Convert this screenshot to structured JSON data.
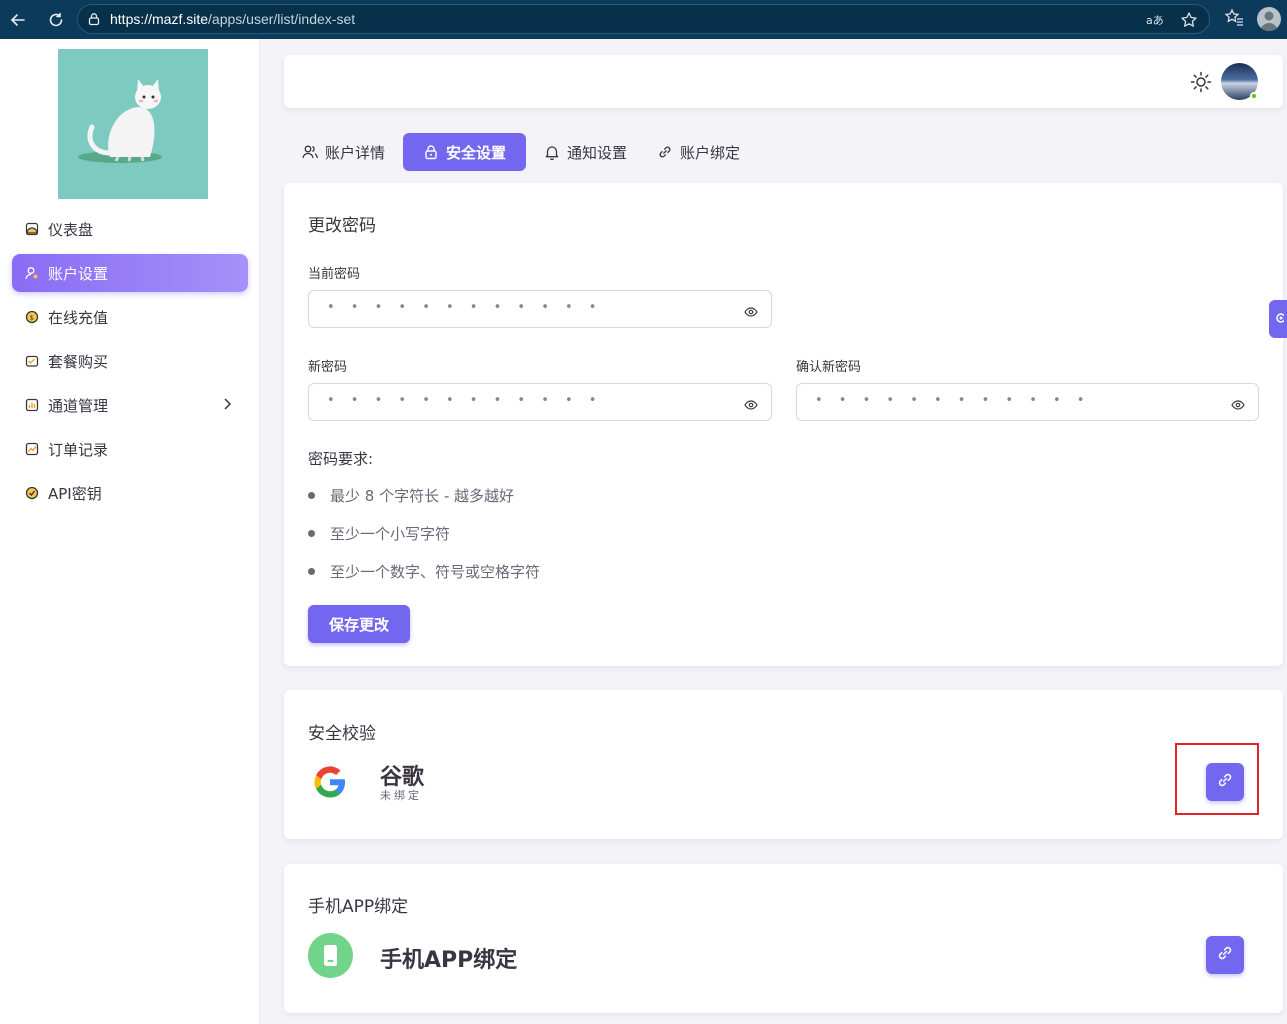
{
  "browser": {
    "url_host": "https://mazf.site",
    "url_path": "/apps/user/list/index-set",
    "icons": [
      "back-arrow-icon",
      "reload-icon",
      "lock-icon",
      "read-aloud-icon",
      "star-icon",
      "favorites-icon",
      "profile-icon"
    ]
  },
  "sidebar": {
    "items": [
      {
        "label": "仪表盘",
        "icon": "dashboard-icon"
      },
      {
        "label": "账户设置",
        "icon": "user-settings-icon",
        "active": true
      },
      {
        "label": "在线充值",
        "icon": "recharge-icon"
      },
      {
        "label": "套餐购买",
        "icon": "package-icon"
      },
      {
        "label": "通道管理",
        "icon": "channel-icon",
        "has_submenu": true
      },
      {
        "label": "订单记录",
        "icon": "order-icon"
      },
      {
        "label": "API密钥",
        "icon": "api-key-icon"
      }
    ]
  },
  "tabs": [
    {
      "label": "账户详情",
      "icon": "users-icon"
    },
    {
      "label": "安全设置",
      "icon": "lock-icon",
      "active": true
    },
    {
      "label": "通知设置",
      "icon": "bell-icon"
    },
    {
      "label": "账户绑定",
      "icon": "link-icon"
    }
  ],
  "password_card": {
    "title": "更改密码",
    "current_label": "当前密码",
    "current_value": "• • • • • • • • • • • •",
    "new_label": "新密码",
    "new_value": "• • • • • • • • • • • •",
    "confirm_label": "确认新密码",
    "confirm_value": "• • • • • • • • • • • •",
    "requirements_title": "密码要求:",
    "requirements": [
      "最少 8 个字符长 - 越多越好",
      "至少一个小写字符",
      "至少一个数字、符号或空格字符"
    ],
    "save_label": "保存更改"
  },
  "security_card": {
    "title": "安全校验",
    "service_name": "谷歌",
    "service_status": "未绑定"
  },
  "app_card": {
    "title": "手机APP绑定",
    "service_name": "手机APP绑定"
  },
  "colors": {
    "primary": "#7367f0",
    "browser_bar": "#0b3a5b",
    "highlight": "#e0242a",
    "phone_green": "#72d48a"
  }
}
